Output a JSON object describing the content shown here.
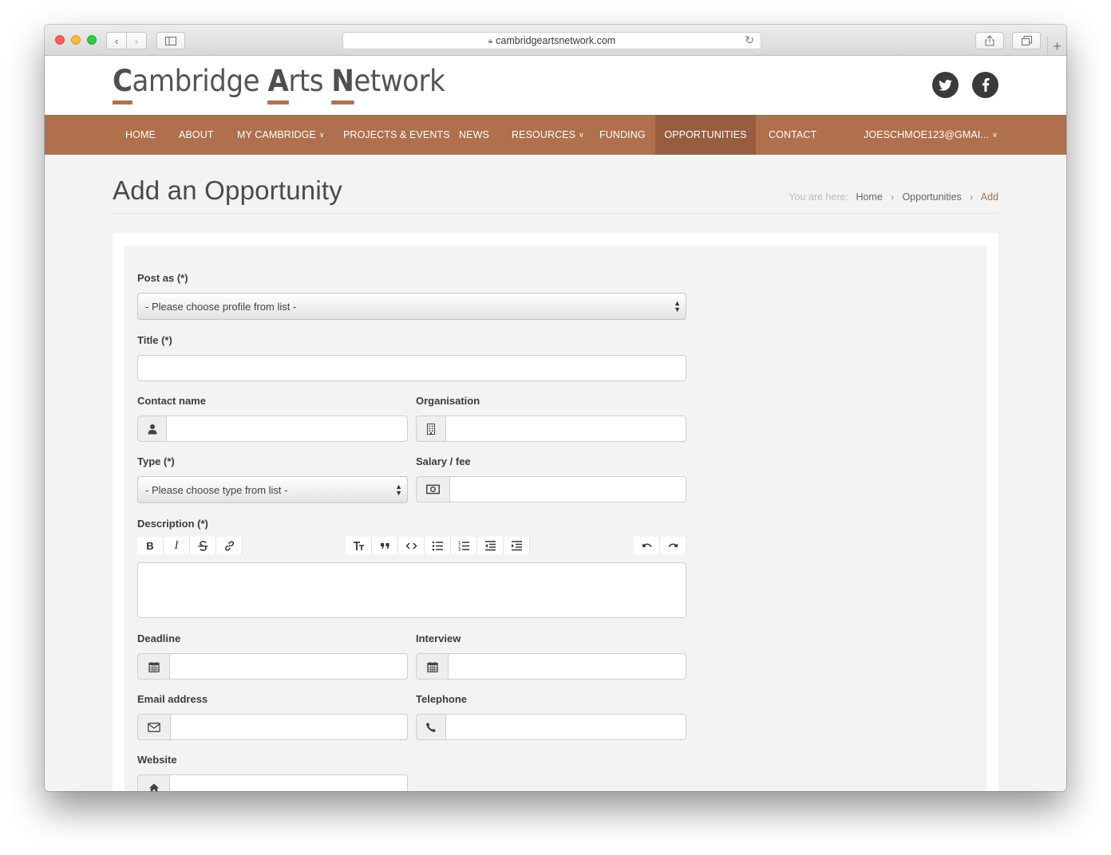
{
  "browser": {
    "url": "cambridgeartsnetwork.com"
  },
  "site": {
    "logo": {
      "c_initial": "C",
      "c_rest": "ambridge ",
      "a_initial": "A",
      "a_rest": "rts ",
      "n_initial": "N",
      "n_rest": "etwork"
    },
    "social": {
      "twitter": "twitter-icon",
      "facebook": "facebook-icon"
    }
  },
  "nav": {
    "items": [
      {
        "label": "HOME",
        "dropdown": false
      },
      {
        "label": "ABOUT",
        "dropdown": false
      },
      {
        "label": "MY CAMBRIDGE",
        "dropdown": true
      },
      {
        "label": "PROJECTS & EVENTS",
        "dropdown": false
      },
      {
        "label": "NEWS",
        "dropdown": false
      },
      {
        "label": "RESOURCES",
        "dropdown": true
      },
      {
        "label": "FUNDING",
        "dropdown": false
      },
      {
        "label": "OPPORTUNITIES",
        "dropdown": false,
        "active": true
      },
      {
        "label": "CONTACT",
        "dropdown": false
      }
    ],
    "user": "JOESCHMOE123@GMAI...",
    "active_bg": "#985d3e",
    "bar_color": "#b0704d"
  },
  "page": {
    "title": "Add an Opportunity",
    "breadcrumb": {
      "lead": "You are here:",
      "items": [
        "Home",
        "Opportunities"
      ],
      "current": "Add"
    }
  },
  "form": {
    "post_as": {
      "label": "Post as (*)",
      "value": "- Please choose profile from list -"
    },
    "title": {
      "label": "Title (*)",
      "value": ""
    },
    "contact_name": {
      "label": "Contact name",
      "value": ""
    },
    "organisation": {
      "label": "Organisation",
      "value": ""
    },
    "type": {
      "label": "Type (*)",
      "value": "- Please choose type from list -"
    },
    "salary": {
      "label": "Salary / fee",
      "value": ""
    },
    "description": {
      "label": "Description (*)",
      "value": ""
    },
    "deadline": {
      "label": "Deadline",
      "value": ""
    },
    "interview": {
      "label": "Interview",
      "value": ""
    },
    "email": {
      "label": "Email address",
      "value": ""
    },
    "telephone": {
      "label": "Telephone",
      "value": ""
    },
    "website": {
      "label": "Website",
      "value": ""
    }
  },
  "toolbar": {
    "bold": "B",
    "italic": "I"
  }
}
